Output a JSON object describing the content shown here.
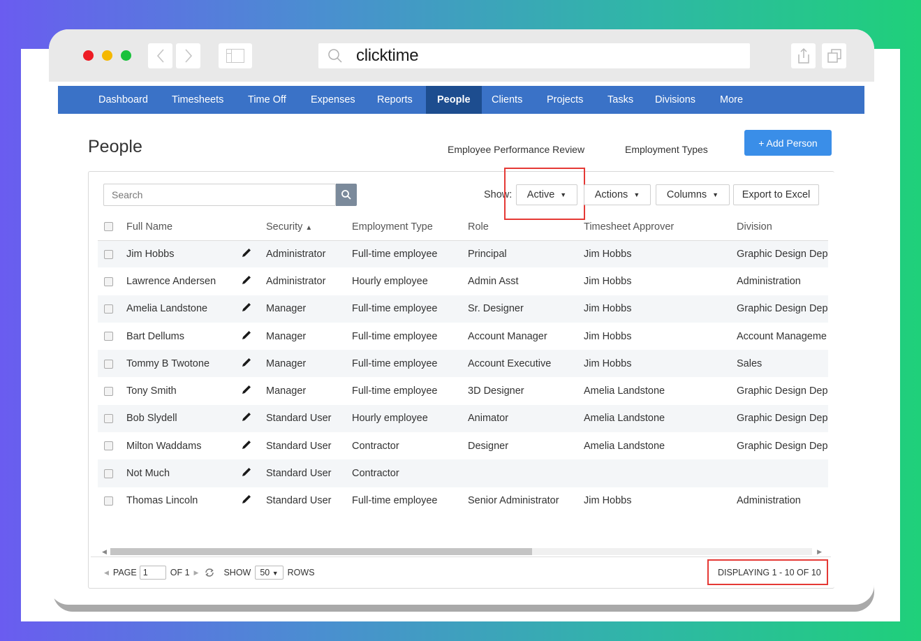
{
  "browser": {
    "url": "clicktime"
  },
  "nav": {
    "items": [
      {
        "label": "Dashboard"
      },
      {
        "label": "Timesheets"
      },
      {
        "label": "Time Off"
      },
      {
        "label": "Expenses"
      },
      {
        "label": "Reports"
      },
      {
        "label": "People",
        "active": true
      },
      {
        "label": "Clients"
      },
      {
        "label": "Projects"
      },
      {
        "label": "Tasks"
      },
      {
        "label": "Divisions"
      },
      {
        "label": "More"
      }
    ]
  },
  "page": {
    "title": "People",
    "link_review": "Employee Performance Review",
    "link_types": "Employment Types",
    "add_button": "+ Add Person"
  },
  "toolbar": {
    "search_placeholder": "Search",
    "show_label": "Show:",
    "show_value": "Active",
    "actions": "Actions",
    "columns": "Columns",
    "export": "Export to Excel"
  },
  "table": {
    "headers": {
      "full_name": "Full Name",
      "security": "Security",
      "employment_type": "Employment Type",
      "role": "Role",
      "approver": "Timesheet Approver",
      "division": "Division"
    },
    "rows": [
      {
        "name": "Jim Hobbs",
        "security": "Administrator",
        "type": "Full-time employee",
        "role": "Principal",
        "approver": "Jim Hobbs",
        "division": "Graphic Design Dep"
      },
      {
        "name": "Lawrence Andersen",
        "security": "Administrator",
        "type": "Hourly employee",
        "role": "Admin Asst",
        "approver": "Jim Hobbs",
        "division": "Administration"
      },
      {
        "name": "Amelia Landstone",
        "security": "Manager",
        "type": "Full-time employee",
        "role": "Sr. Designer",
        "approver": "Jim Hobbs",
        "division": "Graphic Design Dep"
      },
      {
        "name": "Bart Dellums",
        "security": "Manager",
        "type": "Full-time employee",
        "role": "Account Manager",
        "approver": "Jim Hobbs",
        "division": "Account Manageme"
      },
      {
        "name": "Tommy B Twotone",
        "security": "Manager",
        "type": "Full-time employee",
        "role": "Account Executive",
        "approver": "Jim Hobbs",
        "division": "Sales"
      },
      {
        "name": "Tony Smith",
        "security": "Manager",
        "type": "Full-time employee",
        "role": "3D Designer",
        "approver": "Amelia Landstone",
        "division": "Graphic Design Dep"
      },
      {
        "name": "Bob Slydell",
        "security": "Standard User",
        "type": "Hourly employee",
        "role": "Animator",
        "approver": "Amelia Landstone",
        "division": "Graphic Design Dep"
      },
      {
        "name": "Milton Waddams",
        "security": "Standard User",
        "type": "Contractor",
        "role": "Designer",
        "approver": "Amelia Landstone",
        "division": "Graphic Design Dep"
      },
      {
        "name": "Not Much",
        "security": "Standard User",
        "type": "Contractor",
        "role": "",
        "approver": "",
        "division": ""
      },
      {
        "name": "Thomas Lincoln",
        "security": "Standard User",
        "type": "Full-time employee",
        "role": "Senior Administrator",
        "approver": "Jim Hobbs",
        "division": "Administration"
      }
    ]
  },
  "pager": {
    "page_label": "PAGE",
    "page_value": "1",
    "of_label": "OF 1",
    "show_label": "SHOW",
    "rows_value": "50",
    "rows_label": "ROWS",
    "displaying": "DISPLAYING 1 - 10 OF 10"
  },
  "colors": {
    "nav_bg": "#3a72c7",
    "nav_active": "#1d4d8f",
    "primary_button": "#3a8ee8",
    "highlight": "#e53935"
  }
}
